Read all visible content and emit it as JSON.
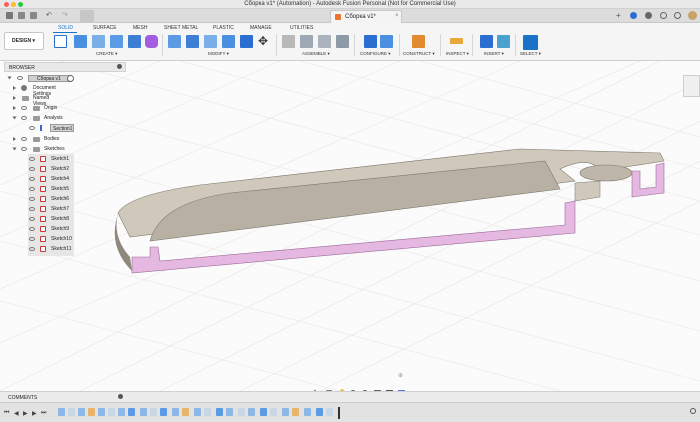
{
  "window": {
    "title": "Сборка v1* (Automation) - Autodesk Fusion Personal (Not for Commercial Use)"
  },
  "doc_tab": {
    "label": "Сборка v1*"
  },
  "workspace": {
    "label": "DESIGN ▾"
  },
  "ribbon_tabs": [
    "SOLID",
    "SURFACE",
    "MESH",
    "SHEET METAL",
    "PLASTIC",
    "MANAGE",
    "UTILITIES"
  ],
  "groups": {
    "create": "CREATE ▾",
    "modify": "MODIFY ▾",
    "assemble": "ASSEMBLE ▾",
    "configure": "CONFIGURE ▾",
    "construct": "CONSTRUCT ▾",
    "inspect": "INSPECT ▾",
    "insert": "INSERT ▾",
    "select": "SELECT ▾"
  },
  "browser": {
    "header": "BROWSER",
    "root": "Сборка v1",
    "items": [
      "Document Settings",
      "Named Views",
      "Origin",
      "Analysis",
      "Section1",
      "Bodies",
      "Sketches"
    ],
    "sketches": [
      "Sketch1",
      "Sketch2",
      "Sketch4",
      "Sketch5",
      "Sketch6",
      "Sketch7",
      "Sketch8",
      "Sketch9",
      "Sketch10",
      "Sketch11"
    ]
  },
  "comments": {
    "label": "COMMENTS"
  },
  "colors": {
    "accent": "#1a73c8",
    "part_face": "#ccc5b8",
    "part_dark": "#8f887d",
    "section": "#e4b8e0"
  }
}
